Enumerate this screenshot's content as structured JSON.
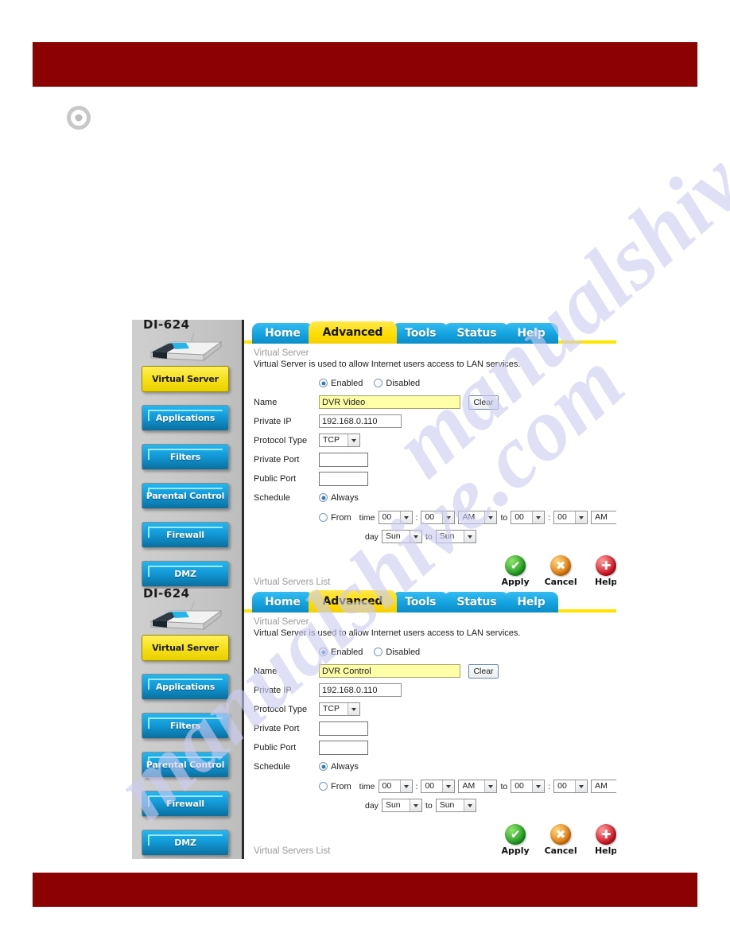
{
  "page": {
    "header_band_color": "#8c0203",
    "footer_band_color": "#8c0203",
    "bullet_icon": "radio-bullet-icon",
    "watermark_text": "manualshive.com"
  },
  "router_ui": {
    "model": "DI-624",
    "tabs": [
      {
        "label": "Home",
        "active": false
      },
      {
        "label": "Advanced",
        "active": true
      },
      {
        "label": "Tools",
        "active": false
      },
      {
        "label": "Status",
        "active": false
      },
      {
        "label": "Help",
        "active": false
      }
    ],
    "sidebar": [
      {
        "label": "Virtual Server",
        "active": true
      },
      {
        "label": "Applications",
        "active": false
      },
      {
        "label": "Filters",
        "active": false
      },
      {
        "label": "Parental Control",
        "active": false
      },
      {
        "label": "Firewall",
        "active": false
      },
      {
        "label": "DMZ",
        "active": false
      }
    ],
    "section_title": "Virtual Server",
    "section_desc": "Virtual Server is used to allow Internet users access to LAN services.",
    "labels": {
      "enabled": "Enabled",
      "disabled": "Disabled",
      "name": "Name",
      "private_ip": "Private IP",
      "protocol_type": "Protocol Type",
      "private_port": "Private Port",
      "public_port": "Public Port",
      "schedule": "Schedule",
      "always": "Always",
      "from": "From",
      "time": "time",
      "day": "day",
      "to": "to",
      "colon": ":",
      "clear": "Clear",
      "list_link": "Virtual Servers List"
    },
    "actions": [
      {
        "label": "Apply",
        "glyph": "✔",
        "color": "green",
        "icon": "check-circle-icon"
      },
      {
        "label": "Cancel",
        "glyph": "✖",
        "color": "orange",
        "icon": "cross-circle-icon"
      },
      {
        "label": "Help",
        "glyph": "✚",
        "color": "red",
        "icon": "plus-circle-icon"
      }
    ],
    "defaults": {
      "private_ip": "192.168.0.110",
      "protocol": "TCP",
      "private_port": "",
      "public_port": "",
      "time_hour_from": "00",
      "time_min_from": "00",
      "ampm_from": "AM",
      "time_hour_to": "00",
      "time_min_to": "00",
      "ampm_to": "AM",
      "day_from": "Sun",
      "day_to": "Sun"
    },
    "screens": [
      {
        "name_value": "DVR Video"
      },
      {
        "name_value": "DVR Control"
      }
    ]
  }
}
